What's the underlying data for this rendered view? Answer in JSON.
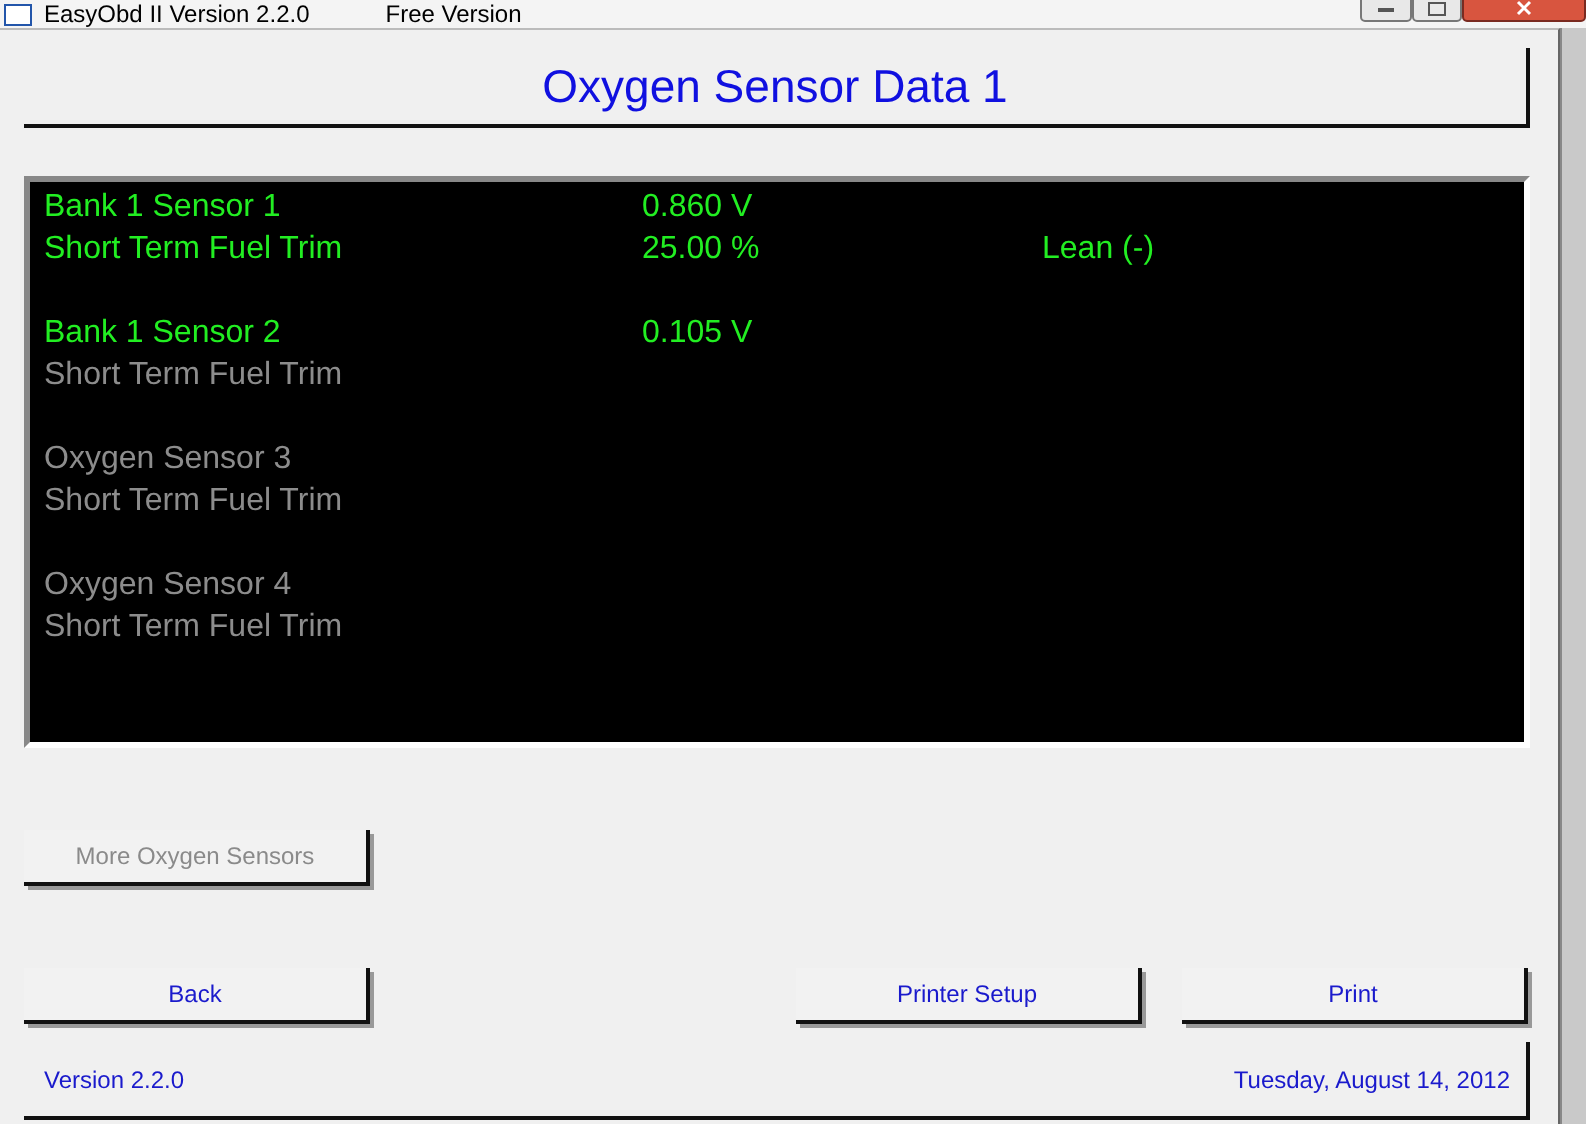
{
  "window": {
    "title": "EasyObd II Version 2.2.0",
    "edition": "Free Version"
  },
  "heading": "Oxygen Sensor Data 1",
  "sensor_groups": [
    {
      "lines": [
        {
          "label": "Bank 1 Sensor 1",
          "value": "0.860 V",
          "active": true
        },
        {
          "label": "Short Term Fuel Trim",
          "value": "25.00 %",
          "note": "Lean (-)",
          "active": true
        }
      ]
    },
    {
      "lines": [
        {
          "label": "Bank 1 Sensor 2",
          "value": "0.105 V",
          "active": true
        },
        {
          "label": "Short Term Fuel Trim",
          "active": false
        }
      ]
    },
    {
      "lines": [
        {
          "label": "Oxygen Sensor 3",
          "active": false
        },
        {
          "label": "Short Term Fuel Trim",
          "active": false
        }
      ]
    },
    {
      "lines": [
        {
          "label": "Oxygen Sensor 4",
          "active": false
        },
        {
          "label": "Short Term Fuel Trim",
          "active": false
        }
      ]
    }
  ],
  "more_button": {
    "label": "More Oxygen Sensors",
    "disabled": true
  },
  "buttons": [
    {
      "label": "Back"
    },
    {
      "label": "Printer Setup"
    },
    {
      "label": "Print"
    }
  ],
  "status_bar": {
    "version": "Version 2.2.0",
    "date": "Tuesday, August 14, 2012"
  }
}
